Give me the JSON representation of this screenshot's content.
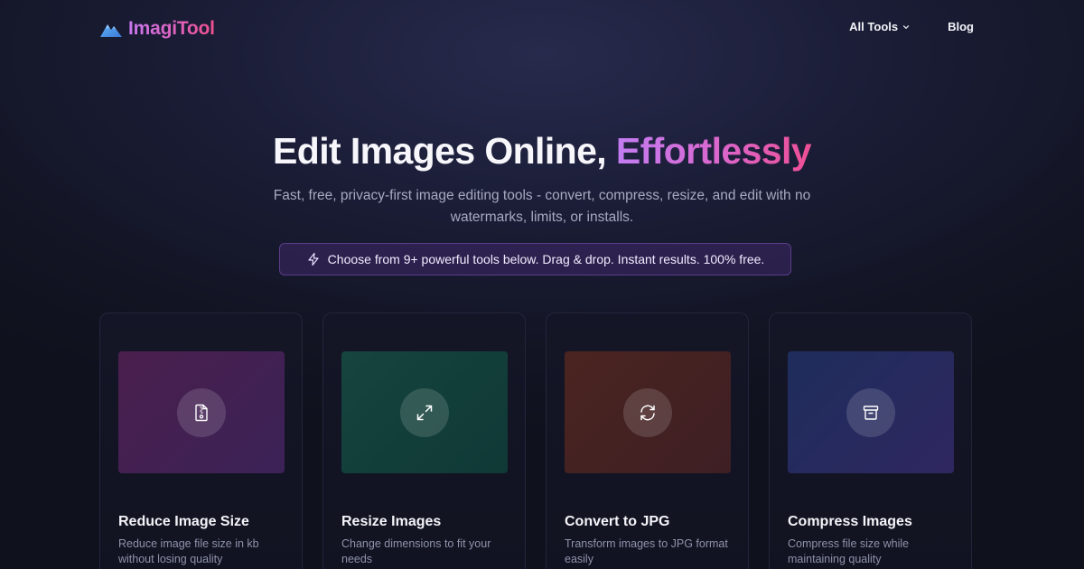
{
  "brand": {
    "name": "ImagiTool"
  },
  "nav": {
    "items": [
      {
        "label": "All Tools",
        "has_dropdown": true
      },
      {
        "label": "Blog",
        "has_dropdown": false
      }
    ]
  },
  "hero": {
    "title_main": "Edit Images Online, ",
    "title_accent": "Effortlessly",
    "subtitle": "Fast, free, privacy-first image editing tools - convert, compress, resize, and edit with no watermarks, limits, or installs.",
    "pill_text": "Choose from 9+ powerful tools below. Drag & drop. Instant results. 100% free.",
    "pill_icon": "lightning-icon"
  },
  "cards": [
    {
      "title": "Reduce Image Size",
      "desc": "Reduce image file size in kb without losing quality",
      "icon": "file-zip-icon",
      "gradient": [
        "#4a1f4d",
        "#3b2257"
      ]
    },
    {
      "title": "Resize Images",
      "desc": "Change dimensions to fit your needs",
      "icon": "expand-arrows-icon",
      "gradient": [
        "#16443e",
        "#0f3936"
      ]
    },
    {
      "title": "Convert to JPG",
      "desc": "Transform images to JPG format easily",
      "icon": "refresh-icon",
      "gradient": [
        "#4a2420",
        "#3e1f24"
      ]
    },
    {
      "title": "Compress Images",
      "desc": "Compress file size while maintaining quality",
      "icon": "archive-box-icon",
      "gradient": [
        "#1e2d5c",
        "#2f2760"
      ]
    }
  ],
  "colors": {
    "brand_gradient_start": "#c778f0",
    "brand_gradient_end": "#f0508e",
    "pill_border": "#5b3d8a",
    "background": "#121423"
  }
}
